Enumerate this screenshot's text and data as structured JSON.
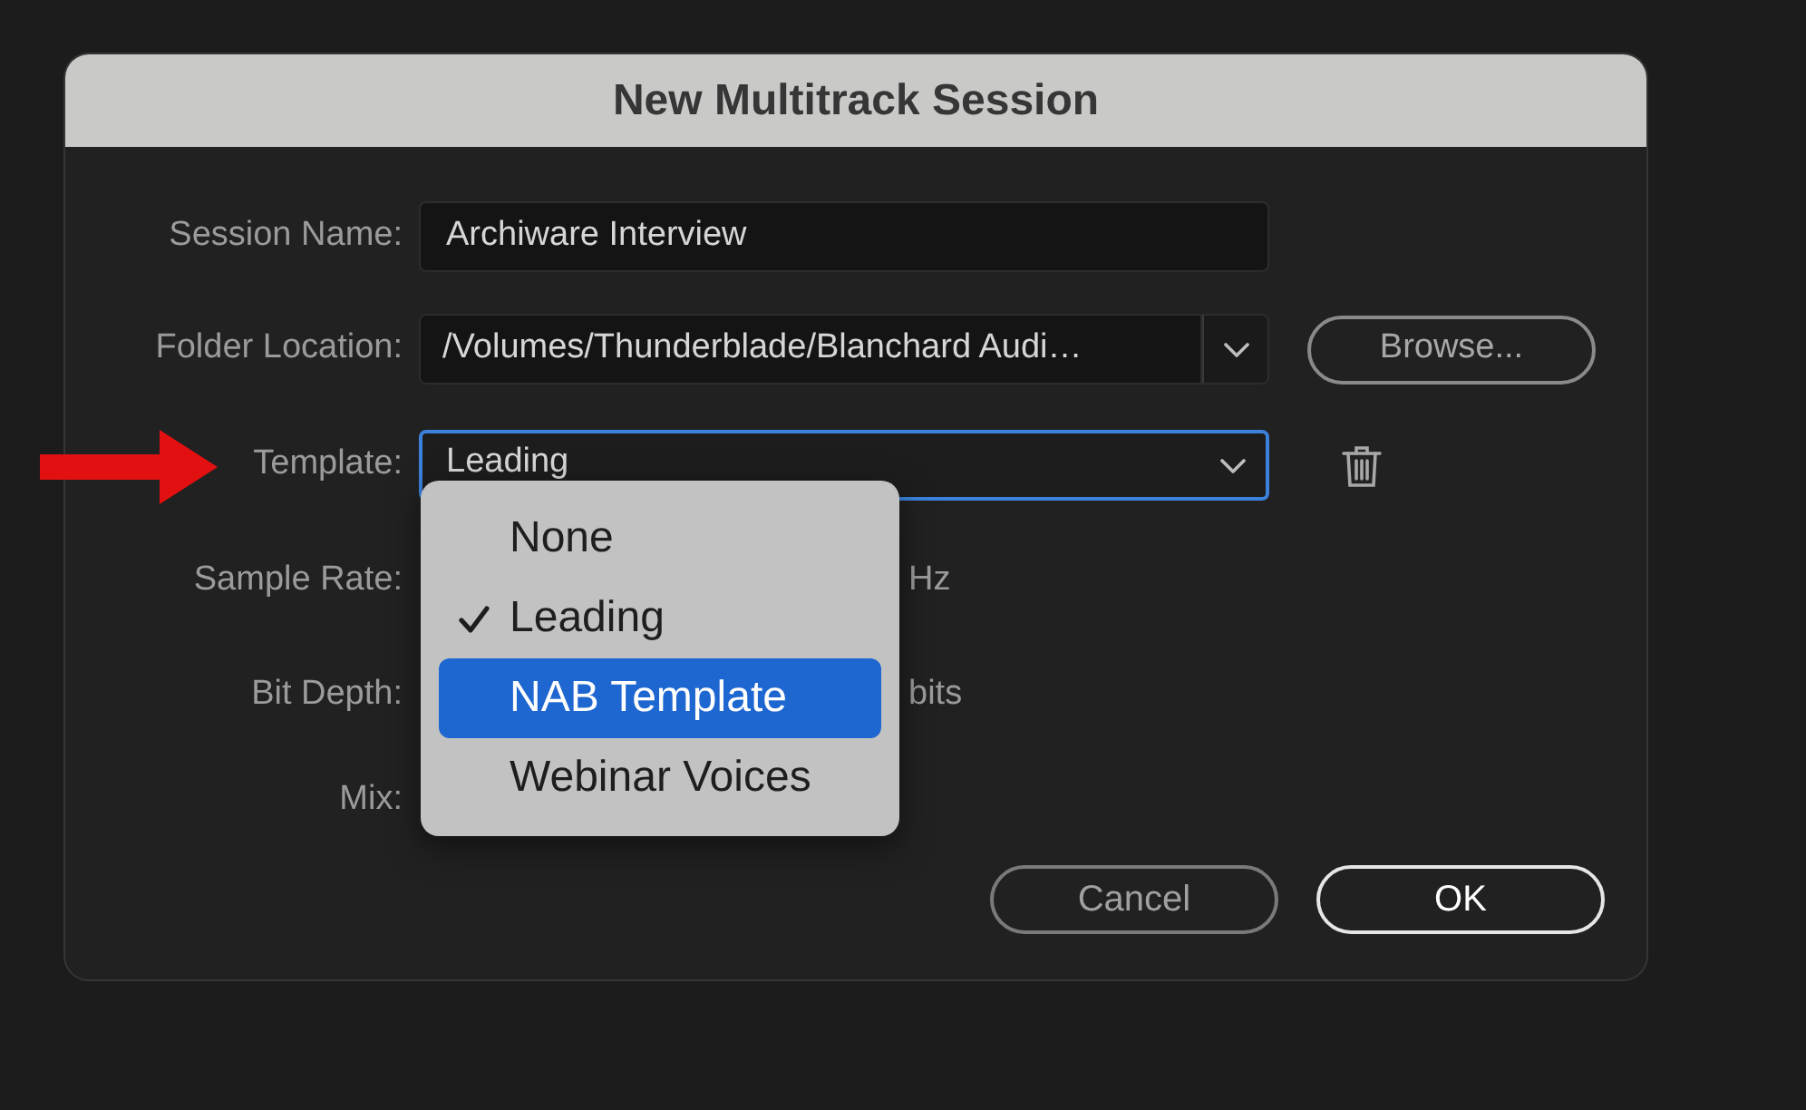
{
  "dialog": {
    "title": "New Multitrack Session"
  },
  "session_name": {
    "label": "Session Name:",
    "value": "Archiware Interview"
  },
  "folder_location": {
    "label": "Folder Location:",
    "value": "/Volumes/Thunderblade/Blanchard Audi…",
    "browse": "Browse..."
  },
  "template": {
    "label": "Template:",
    "value": "Leading",
    "focused": true
  },
  "template_menu": [
    {
      "label": "None",
      "checked": false,
      "selected": false
    },
    {
      "label": "Leading",
      "checked": true,
      "selected": false
    },
    {
      "label": "NAB Template",
      "checked": false,
      "selected": true
    },
    {
      "label": "Webinar Voices",
      "checked": false,
      "selected": false
    }
  ],
  "sample_rate": {
    "label": "Sample Rate:",
    "unit": "Hz"
  },
  "bit_depth": {
    "label": "Bit Depth:",
    "unit": "bits"
  },
  "mix": {
    "label": "Mix:"
  },
  "buttons": [
    {
      "label": "Cancel",
      "kind": "secondary"
    },
    {
      "label": "OK",
      "kind": "default"
    }
  ]
}
